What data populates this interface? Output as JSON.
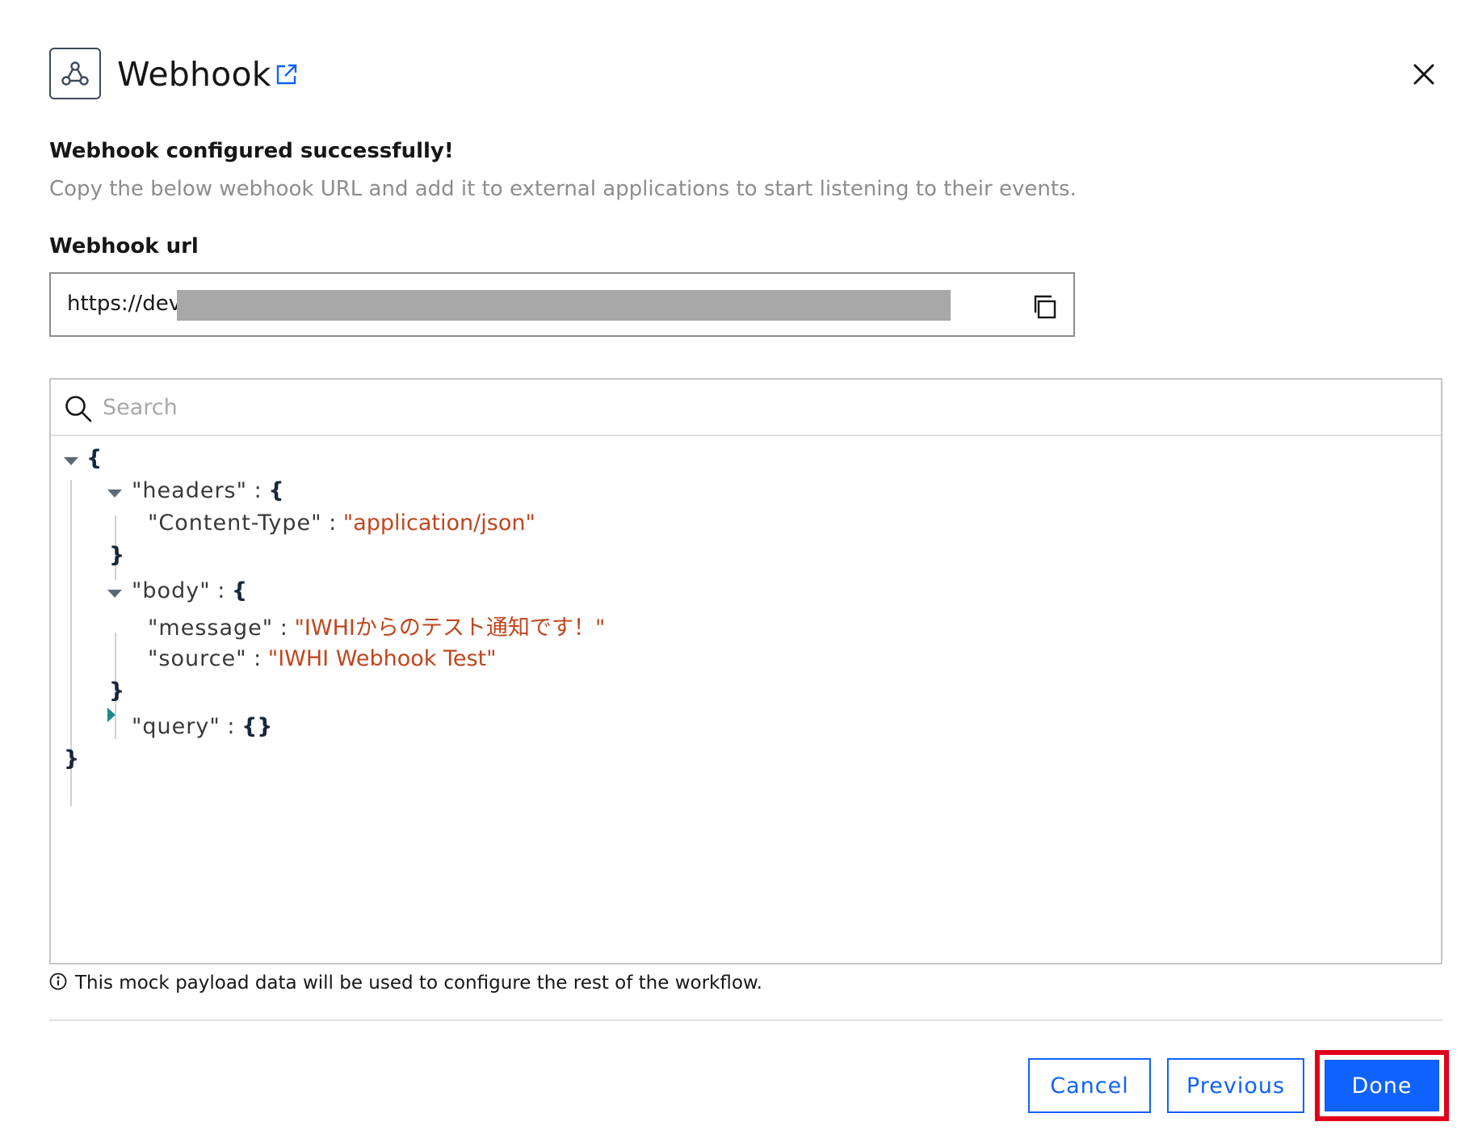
{
  "header": {
    "title": "Webhook",
    "app_icon": "webhook-icon",
    "external_link_icon": "external-link-icon",
    "close_icon": "close-icon"
  },
  "message": {
    "heading": "Webhook configured successfully!",
    "description": "Copy the below webhook URL and add it to external applications to start listening to their events."
  },
  "url_field": {
    "label": "Webhook url",
    "value": "https://dev",
    "copy_icon": "copy-icon"
  },
  "viewer": {
    "search_placeholder": "Search",
    "json": {
      "open_root": "{",
      "headers_key": "\"headers\"",
      "headers_open": "{",
      "content_type_key": "\"Content-Type\"",
      "content_type_value": "\"application/json\"",
      "headers_close": "}",
      "body_key": "\"body\"",
      "body_open": "{",
      "message_key": "\"message\"",
      "message_value": "\"IWHIからのテスト通知です！\"",
      "source_key": "\"source\"",
      "source_value": "\"IWHI Webhook Test\"",
      "body_close": "}",
      "query_key": "\"query\"",
      "query_value": "{}",
      "close_root": "}",
      "separator": ":"
    }
  },
  "info": {
    "text": "This mock payload data will be used to configure the rest of the workflow.",
    "icon": "info-icon"
  },
  "footer": {
    "cancel_label": "Cancel",
    "previous_label": "Previous",
    "done_label": "Done"
  },
  "colors": {
    "primary": "#0f62fe",
    "highlight": "#e0001b",
    "string_value": "#c0461d"
  }
}
